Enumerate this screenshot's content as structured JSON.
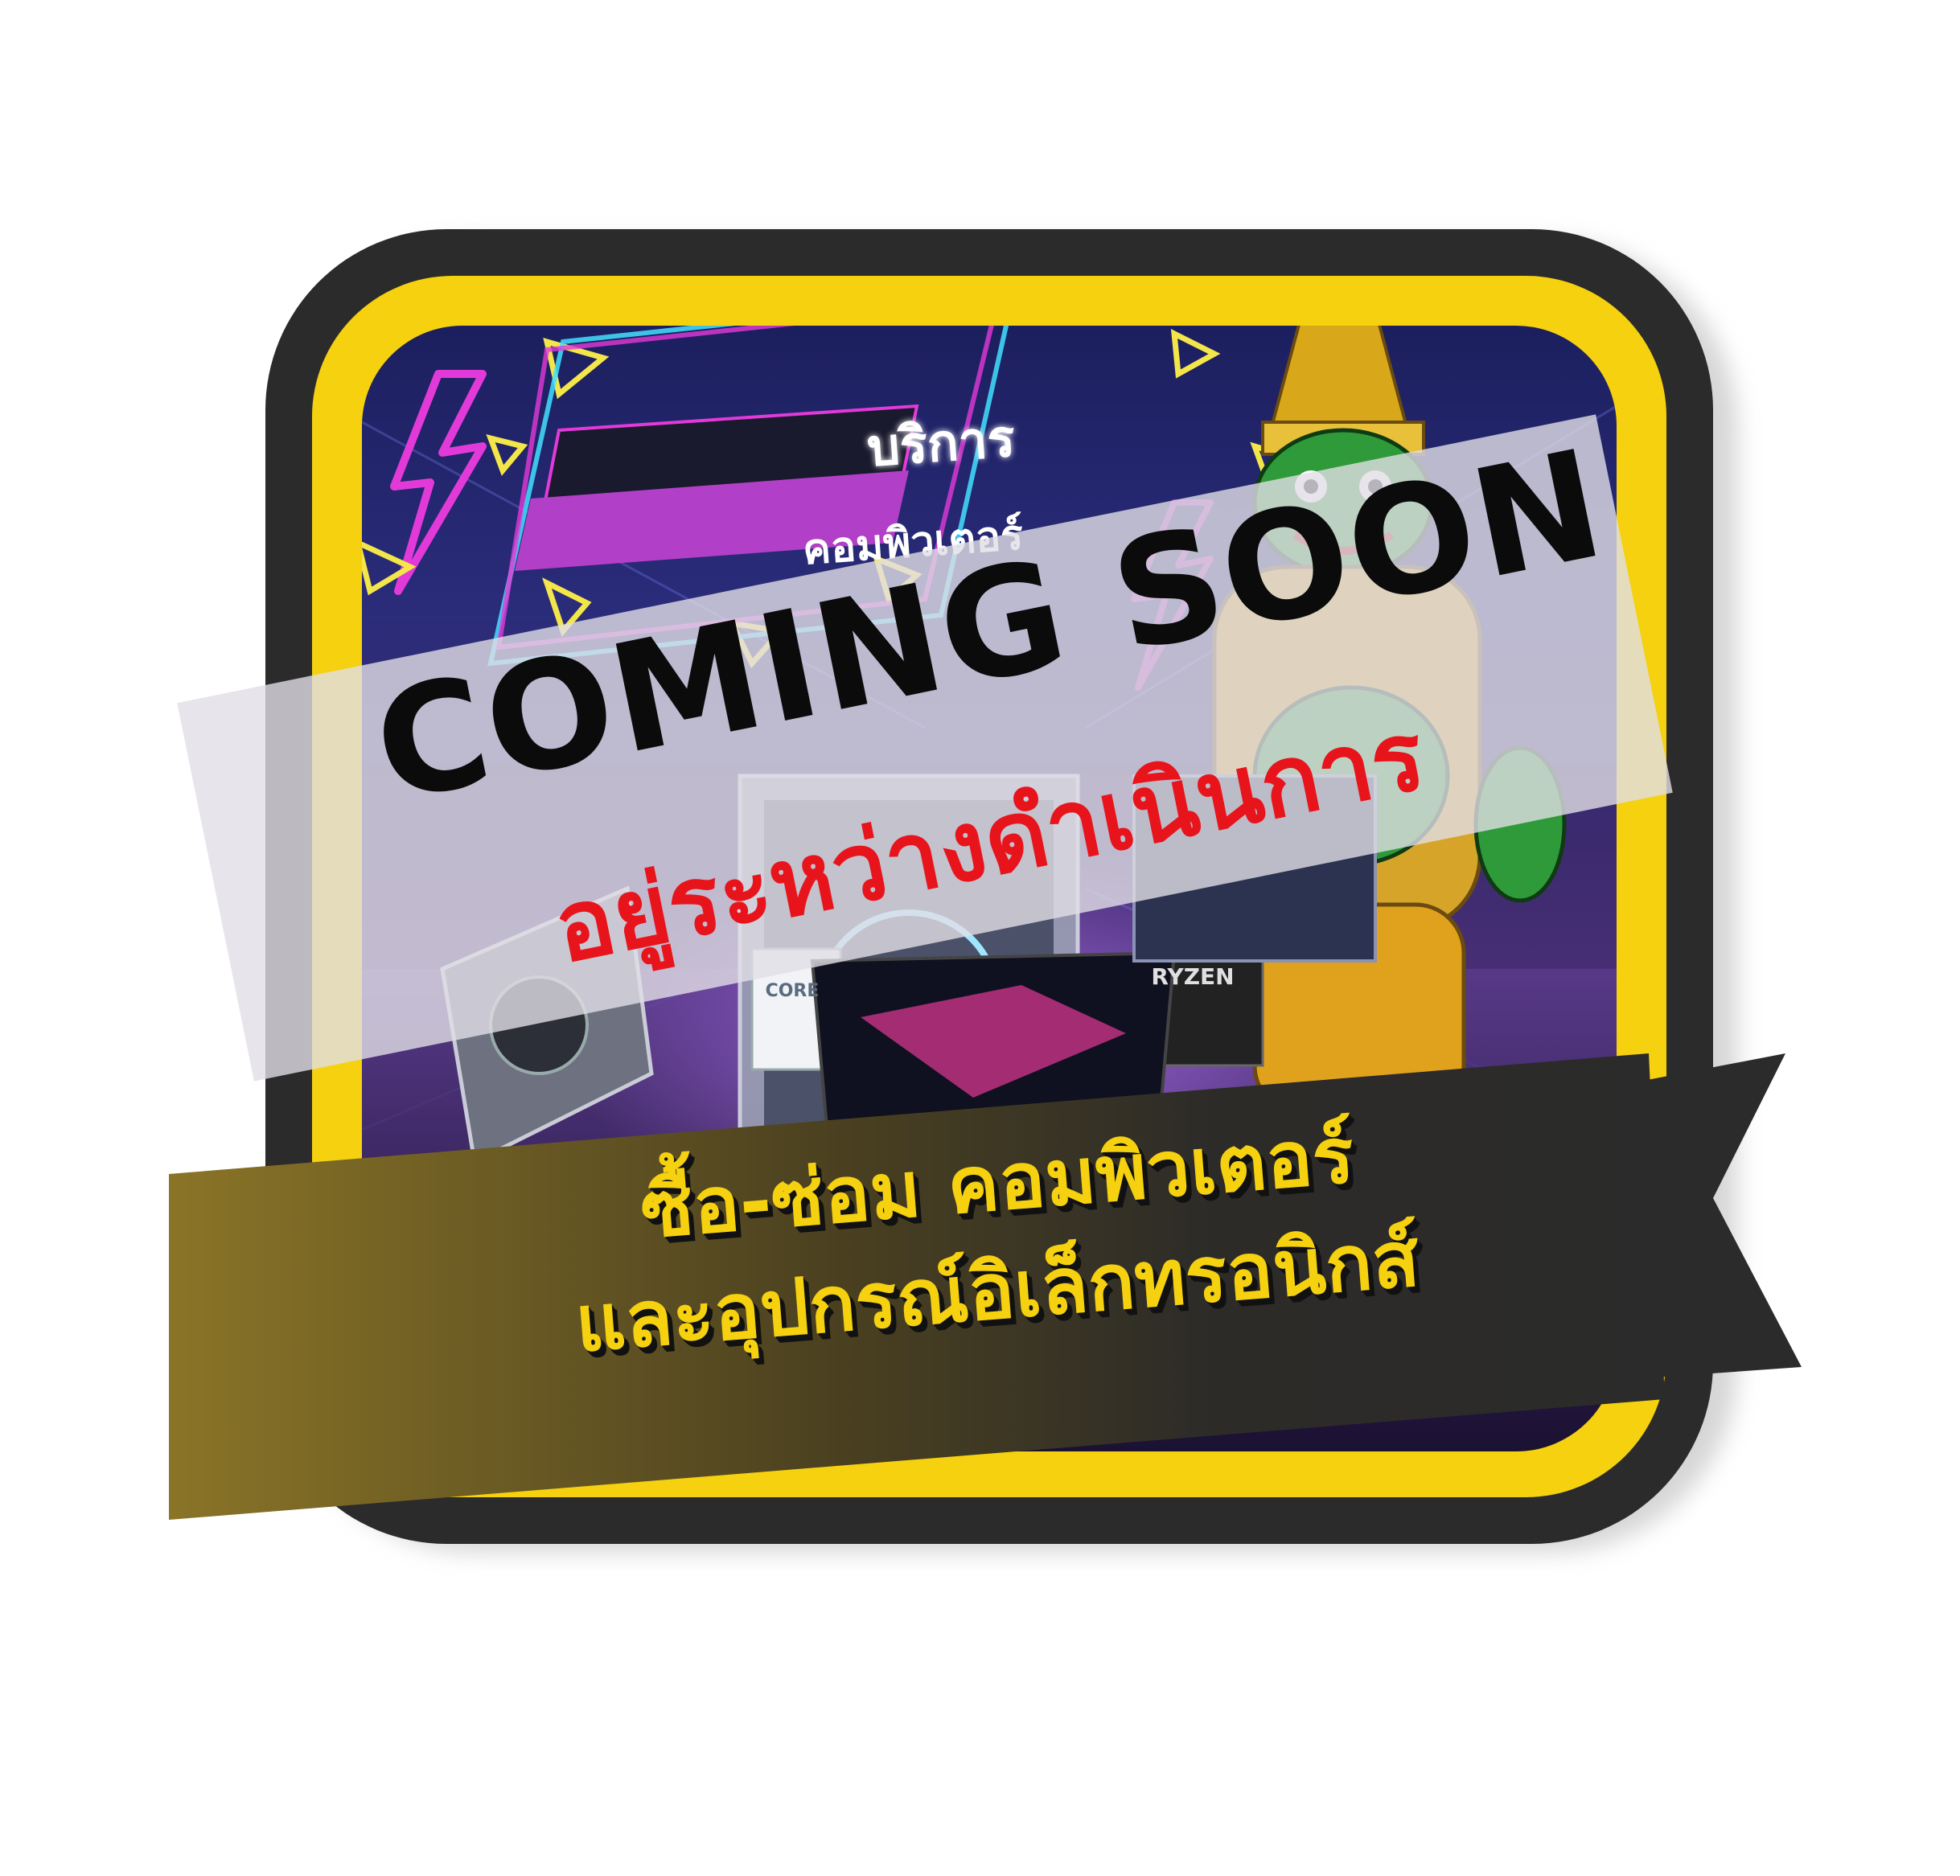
{
  "badge": {
    "sign_title": "บริการ",
    "sign_subtitle": "คอมพิวเตอร์",
    "headline": "COMING SOON",
    "status": "อยู่ระหว่างดำเนินการ",
    "ribbon_line1": "ซื้อ-ซ่อม คอมพิวเตอร์",
    "ribbon_line2": "และอุปกรณ์อิเล็กทรอนิกส์"
  },
  "products": {
    "cpu_left": "CORE",
    "cpu_right": "RYZEN"
  },
  "colors": {
    "frame_dark": "#2b2b2b",
    "frame_yellow": "#f5d10f",
    "headline_text": "#0b0b0b",
    "status_text": "#e8141c",
    "ribbon_text": "#f5d10f",
    "neon_pink": "#e23ad8",
    "neon_yellow": "#f3e64a",
    "neon_cyan": "#42e0ff"
  },
  "icons": [
    "lightning-bolt-icon",
    "neon-triangle-icon",
    "giant-guardian-mascot",
    "laptop-image",
    "pc-tower-image",
    "graphics-card-image"
  ]
}
